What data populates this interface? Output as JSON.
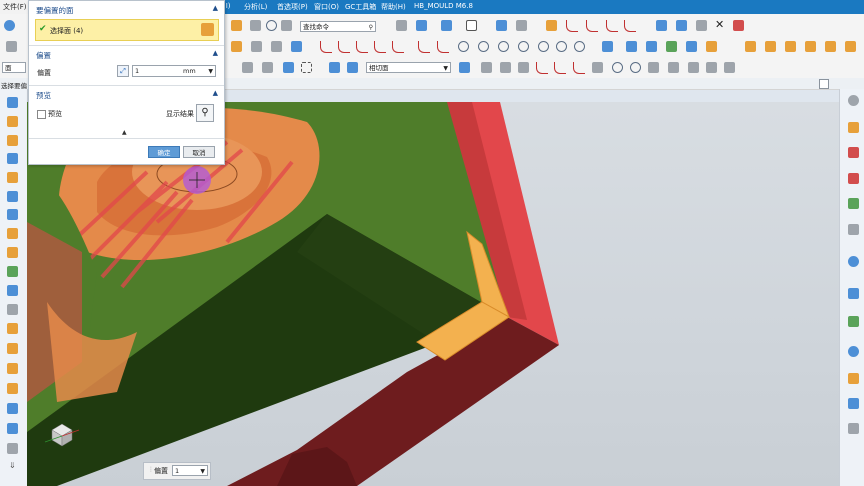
{
  "menubar": {
    "items": [
      "文件(F)",
      "(I)",
      "分析(L)",
      "首选项(P)",
      "窗口(O)",
      "GC工具箱",
      "帮助(H)",
      "HB_MOULD M6.8"
    ]
  },
  "toolbar": {
    "command_finder_placeholder": "查找命令",
    "filter_value": "相切面",
    "left_combo_value": "面"
  },
  "resource_bar": {
    "selection_label": "选择要偏"
  },
  "dialog": {
    "title": "要偏置的面",
    "select_face_label": "选择面 (4)",
    "offset_section": "偏置",
    "offset_label": "偏置",
    "offset_value": "1",
    "offset_unit": "mm",
    "preview_section": "预览",
    "preview_checkbox_label": "预览",
    "show_result_label": "显示结果",
    "ok_label": "确定",
    "cancel_label": "取消"
  },
  "float_toolbar": {
    "offset_label": "偏置",
    "offset_value": "1"
  },
  "colors": {
    "menubar": "#1a79c1",
    "selected_row": "#fdf0a6",
    "face_green": "#4f7d2a",
    "face_red": "#e2474b",
    "face_orange": "#e48a4a",
    "dark_green": "#1f3a0f",
    "dark_red": "#6e1c1e"
  }
}
